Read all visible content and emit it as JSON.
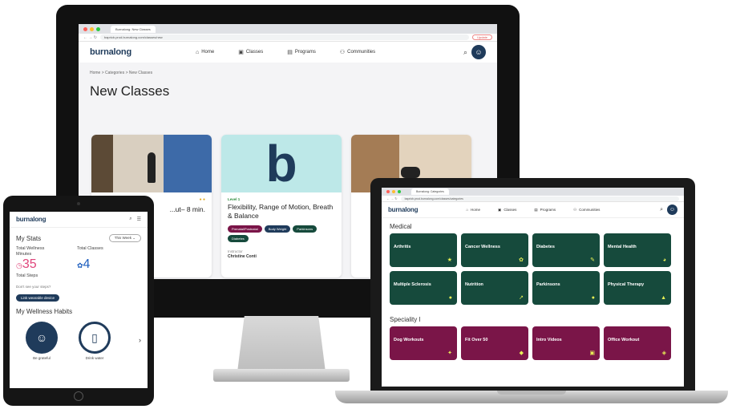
{
  "desktop": {
    "browser": {
      "tab_title": "Burnalong: New Classes",
      "url": "bapricb.prod.burnalong.com/classes/new",
      "update_label": "Update"
    },
    "site": {
      "logo": "burnalong",
      "nav": [
        {
          "label": "Home",
          "icon": "home-icon"
        },
        {
          "label": "Classes",
          "icon": "classes-icon"
        },
        {
          "label": "Programs",
          "icon": "programs-icon"
        },
        {
          "label": "Communities",
          "icon": "communities-icon"
        }
      ],
      "breadcrumb": "Home  >  Categories  >  New Classes",
      "page_title": "New Classes"
    },
    "cards": [
      {
        "title": "...ut– 8 min.",
        "level": "",
        "chips": [],
        "instructor_label": "",
        "instructor": ""
      },
      {
        "title": "Flexibility, Range of Motion, Breath & Balance",
        "level": "Level 1",
        "chips": [
          {
            "label": "Prenatal/Postnatal",
            "color": "#7a1548"
          },
          {
            "label": "Body Weight",
            "color": "#1f3b5b"
          },
          {
            "label": "Parkinsons",
            "color": "#164a3c"
          },
          {
            "label": "Diabetes",
            "color": "#164a3c"
          }
        ],
        "instructor_label": "Instructor",
        "instructor": "Christine Conti"
      },
      {
        "title": "",
        "level": "",
        "chips": [],
        "instructor_label": "",
        "instructor": ""
      }
    ]
  },
  "laptop": {
    "browser": {
      "tab_title": "Burnalong: Categories",
      "url": "bapricb.prod.burnalong.com/classes/categories"
    },
    "site": {
      "logo": "burnalong",
      "nav": [
        "Home",
        "Classes",
        "Programs",
        "Communities"
      ]
    },
    "sections": [
      {
        "title": "Medical",
        "color": "#164a3c",
        "tiles": [
          {
            "label": "Arthritis",
            "icon": "★"
          },
          {
            "label": "Cancer Wellness",
            "icon": "✿"
          },
          {
            "label": "Diabetes",
            "icon": "✎"
          },
          {
            "label": "Mental Health",
            "icon": "◕"
          },
          {
            "label": "Multiple Sclerosis",
            "icon": "●"
          },
          {
            "label": "Nutrition",
            "icon": "↗"
          },
          {
            "label": "Parkinsons",
            "icon": "●"
          },
          {
            "label": "Physical Therapy",
            "icon": "▲"
          }
        ]
      },
      {
        "title": "Speciality l",
        "color": "#7a1548",
        "tiles": [
          {
            "label": "Dog Workouts",
            "icon": "✦"
          },
          {
            "label": "Fit Over 50",
            "icon": "◆"
          },
          {
            "label": "Intro Videos",
            "icon": "▣"
          },
          {
            "label": "Office Workout",
            "icon": "◈"
          }
        ]
      }
    ]
  },
  "tablet": {
    "logo": "burnalong",
    "my_stats": "My Stats",
    "time_filter": "This Week",
    "stats": [
      {
        "label": "Total Wellness Minutes",
        "value": "35",
        "color": "#e0457b"
      },
      {
        "label": "Total Classes",
        "value": "4",
        "color": "#1f5fbf"
      }
    ],
    "steps_label": "Total Steps",
    "sync_text": "Don't see your steps?",
    "link_button": "Link wearable device",
    "habits_title": "My Wellness Habits",
    "habits": [
      {
        "label": "Be grateful",
        "icon": "☺"
      },
      {
        "label": "Drink water",
        "icon": "▯"
      }
    ]
  },
  "colors": {
    "brand_navy": "#1f3b5b",
    "medical_green": "#164a3c",
    "speciality_magenta": "#7a1548",
    "icon_yellow": "#e7ef55"
  }
}
